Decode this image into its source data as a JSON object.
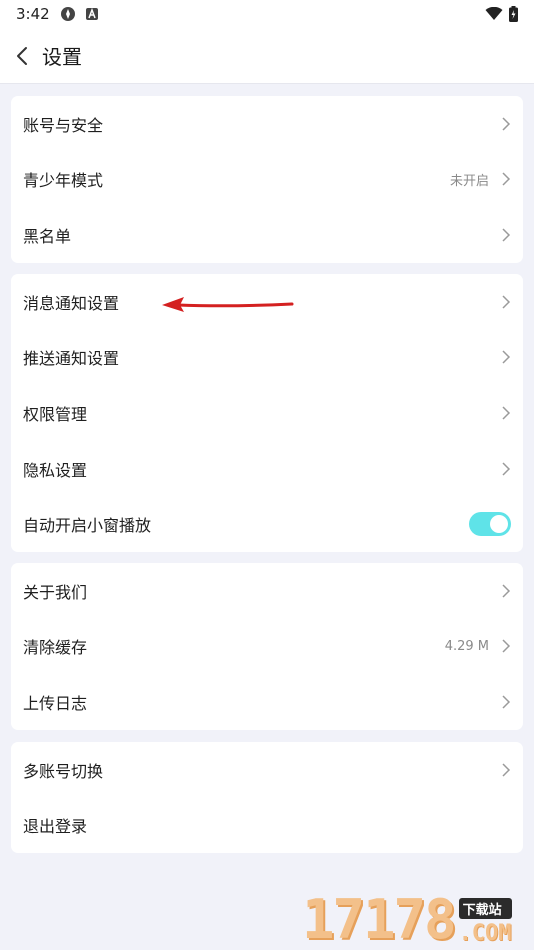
{
  "status": {
    "time": "3:42"
  },
  "header": {
    "title": "设置"
  },
  "group1": [
    {
      "label": "账号与安全"
    },
    {
      "label": "青少年模式",
      "value": "未开启"
    },
    {
      "label": "黑名单"
    }
  ],
  "group2": [
    {
      "label": "消息通知设置"
    },
    {
      "label": "推送通知设置"
    },
    {
      "label": "权限管理"
    },
    {
      "label": "隐私设置"
    },
    {
      "label": "自动开启小窗播放",
      "toggle_on": true
    }
  ],
  "group3": [
    {
      "label": "关于我们"
    },
    {
      "label": "清除缓存",
      "value": "4.29 M"
    },
    {
      "label": "上传日志"
    }
  ],
  "group4": [
    {
      "label": "多账号切换"
    },
    {
      "label": "退出登录"
    }
  ],
  "watermark": {
    "number": "17178",
    "badge": "下载站",
    "domain": ".COM"
  },
  "colors": {
    "toggle_accent": "#5fe3e8",
    "annotation_arrow": "#d42020"
  }
}
